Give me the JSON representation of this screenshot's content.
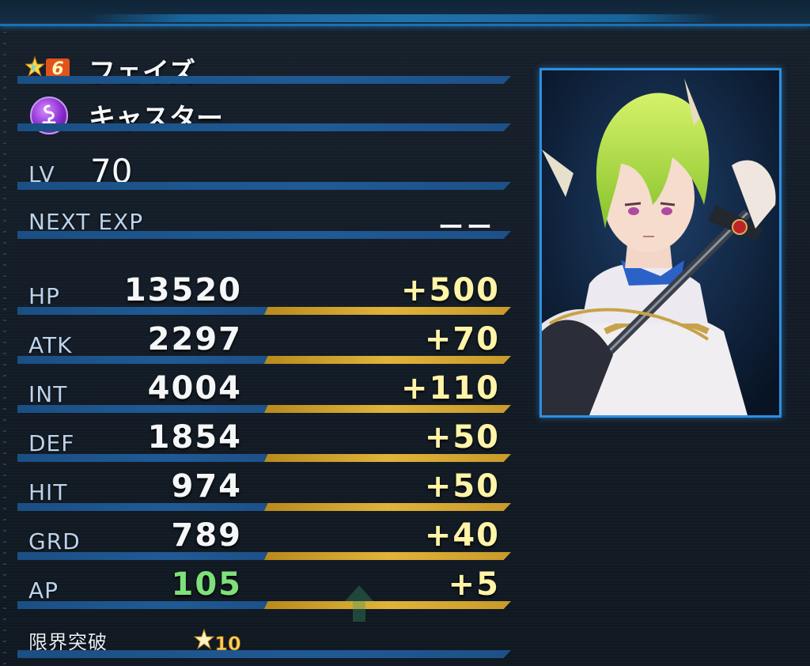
{
  "character": {
    "rarity": "6",
    "name": "フェイズ",
    "class": "キャスター"
  },
  "level": {
    "label": "LV",
    "value": "70"
  },
  "next_exp": {
    "label": "NEXT EXP",
    "value": "ーー"
  },
  "stats": [
    {
      "label": "HP",
      "value": "13520",
      "bonus": "+500",
      "value_color": "#f4f6f8"
    },
    {
      "label": "ATK",
      "value": "2297",
      "bonus": "+70",
      "value_color": "#f4f6f8"
    },
    {
      "label": "INT",
      "value": "4004",
      "bonus": "+110",
      "value_color": "#f4f6f8"
    },
    {
      "label": "DEF",
      "value": "1854",
      "bonus": "+50",
      "value_color": "#f4f6f8"
    },
    {
      "label": "HIT",
      "value": "974",
      "bonus": "+50",
      "value_color": "#f4f6f8"
    },
    {
      "label": "GRD",
      "value": "789",
      "bonus": "+40",
      "value_color": "#f4f6f8"
    },
    {
      "label": "AP",
      "value": "105",
      "bonus": "+5",
      "value_color": "#7ee07a"
    }
  ],
  "limit_break": {
    "label": "限界突破",
    "count": "10"
  },
  "icons": {
    "rarity": "star-icon",
    "class": "caster-class-icon",
    "limit": "limit-break-icon",
    "arrow": "up-arrow-icon"
  },
  "colors": {
    "accent": "#2e8fe0",
    "bar_blue": "#205a95",
    "bar_gold": "#e0b33a",
    "bonus_text": "#fff4a8",
    "ap_green": "#7ee07a"
  }
}
